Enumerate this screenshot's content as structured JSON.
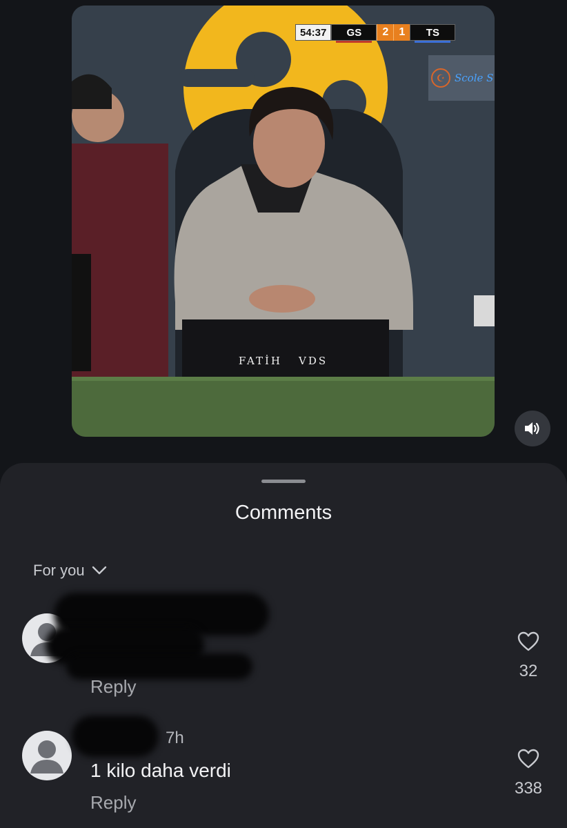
{
  "video": {
    "scoreboard": {
      "clock": "54:37",
      "home_team": "GS",
      "home_score": "2",
      "away_score": "1",
      "away_team": "TS"
    },
    "channel_logo_text": "Scole S",
    "watermark": [
      "FATİH",
      "VDS"
    ],
    "mute_icon": "speaker-sound-icon"
  },
  "comments_sheet": {
    "title": "Comments",
    "sort_label": "For you",
    "reply_label": "Reply",
    "items": [
      {
        "author": "",
        "time": "",
        "text": "",
        "likes": "32"
      },
      {
        "author": "",
        "time": "7h",
        "text": "1 kilo daha verdi",
        "likes": "338"
      }
    ]
  },
  "colors": {
    "background": "#131519",
    "sheet": "#212227",
    "score_orange": "#e8801f",
    "home_stripe": "#c0392b",
    "away_stripe": "#3b6fd8"
  }
}
